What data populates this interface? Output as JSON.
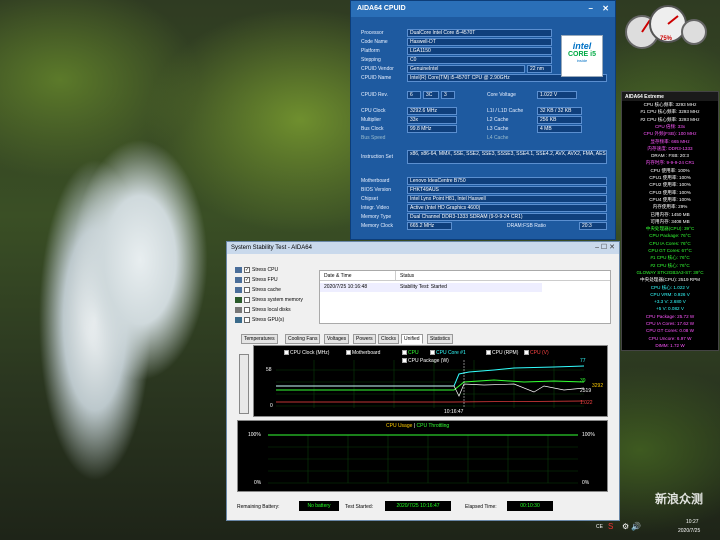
{
  "cpuid": {
    "title": "AIDA64 CPUID",
    "processor": {
      "label": "Processor",
      "value": "DualCore Intel Core i5-4570T"
    },
    "code_name": {
      "label": "Code Name",
      "value": "Haswell-DT"
    },
    "platform": {
      "label": "Platform",
      "value": "LGA1150"
    },
    "stepping": {
      "label": "Stepping",
      "value": "C0"
    },
    "vendor": {
      "label": "CPUID Vendor",
      "value": "GenuineIntel",
      "extra": "22 nm"
    },
    "name": {
      "label": "CPUID Name",
      "value": "Intel(R) Core(TM) i5-4570T CPU @ 2.90GHz"
    },
    "rev": {
      "label": "CPUID Rev.",
      "v1": "6",
      "v2": "3C",
      "v3": "3"
    },
    "core_voltage": {
      "label": "Core Voltage",
      "value": "1.022 V"
    },
    "cpu_clock": {
      "label": "CPU Clock",
      "value": "3292.6 MHz"
    },
    "multiplier": {
      "label": "Multiplier",
      "value": "33x"
    },
    "bus_clock": {
      "label": "Bus Clock",
      "value": "99.8 MHz"
    },
    "bus_speed": {
      "label": "Bus Speed"
    },
    "l1": {
      "label": "L1I / L1D Cache",
      "value": "32 KB / 32 KB"
    },
    "l2": {
      "label": "L2 Cache",
      "value": "256 KB"
    },
    "l3": {
      "label": "L3 Cache",
      "value": "4 MB"
    },
    "l4": {
      "label": "L4 Cache"
    },
    "iset": {
      "label": "Instruction Set",
      "value": "x86, x86-64, MMX, SSE, SSE2, SSE3, SSSE3, SSE4.1, SSE4.2, AVX, AVX2, FMA, AES"
    },
    "motherboard": {
      "label": "Motherboard",
      "value": "Lenovo IdeaCentre B750"
    },
    "bios": {
      "label": "BIOS Version",
      "value": "FHKT49AUS"
    },
    "chipset": {
      "label": "Chipset",
      "value": "Intel Lynx Point H81, Intel Haswell"
    },
    "video": {
      "label": "Integr. Video",
      "value": "Active (Intel HD Graphics 4600)"
    },
    "memtype": {
      "label": "Memory Type",
      "value": "Dual Channel DDR3-1333 SDRAM (9-9-9-24 CR1)"
    },
    "memclock": {
      "label": "Memory Clock",
      "value": "665.2 MHz"
    },
    "ratio": {
      "label": "DRAM:FSB Ratio",
      "value": "20:3"
    },
    "intel": {
      "brand": "intel",
      "core": "CORE i5",
      "inside": "inside"
    }
  },
  "stability": {
    "title": "System Stability Test - AIDA64",
    "checks": [
      {
        "label": "Stress CPU",
        "checked": true
      },
      {
        "label": "Stress FPU",
        "checked": true
      },
      {
        "label": "Stress cache",
        "checked": false
      },
      {
        "label": "Stress system memory",
        "checked": false
      },
      {
        "label": "Stress local disks",
        "checked": false
      },
      {
        "label": "Stress GPU(s)",
        "checked": false
      }
    ],
    "table": {
      "col1": "Date & Time",
      "col2": "Status",
      "row_time": "2020/7/25 10:16:48",
      "row_status": "Stability Test: Started"
    },
    "tabs": [
      "Temperatures",
      "Cooling Fans",
      "Voltages",
      "Powers",
      "Clocks",
      "Unified",
      "Statistics"
    ],
    "active_tab": "Unified",
    "legend": [
      {
        "label": "CPU Clock (MHz)",
        "color": "#ffffff",
        "checked": true
      },
      {
        "label": "Motherboard",
        "color": "#ffffff",
        "checked": false
      },
      {
        "label": "CPU",
        "color": "#33ff33",
        "checked": true
      },
      {
        "label": "CPU Core #1",
        "color": "#33ffff",
        "checked": true
      },
      {
        "label": "CPU (RPM)",
        "color": "#ffffff",
        "checked": true
      },
      {
        "label": "CPU (V)",
        "color": "#ff4444",
        "checked": true
      },
      {
        "label": "CPU Package (W)",
        "color": "#ffffff",
        "checked": false
      }
    ],
    "graph1": {
      "ymax": "58",
      "ymin": "0",
      "time": "10:16:47",
      "r1": "77",
      "r2": "39",
      "r3": "3292",
      "r4": "2519",
      "r5": "1.022"
    },
    "graph2": {
      "title_a": "CPU Usage",
      "sep": "|",
      "title_b": "CPU Throttling",
      "ytop": "100%",
      "ybot": "0%",
      "rtop": "100%",
      "rbot": "0%"
    },
    "remaining_label": "Remaining Battery:",
    "remaining_value": "No battery",
    "started_label": "Test Started:",
    "started_value": "2020/7/25 10:16:47",
    "elapsed_label": "Elapsed Time:",
    "elapsed_value": "00:10:30"
  },
  "extreme": {
    "title": "AIDA64 Extreme",
    "lines": [
      {
        "t": "CPU 核心频率: 3293 MHz",
        "c": "#ffffff"
      },
      {
        "t": "#1 CPU 核心频率: 3293 MHz",
        "c": "#ffffff"
      },
      {
        "t": "#2 CPU 核心频率: 3293 MHz",
        "c": "#ffffff"
      },
      {
        "t": "CPU 倍频: 33x",
        "c": "#ff55ff"
      },
      {
        "t": "CPU 外频(FSB): 100 MHz",
        "c": "#ff55ff"
      },
      {
        "t": "显存频率: 665 MHz",
        "c": "#ff55ff"
      },
      {
        "t": "内存速度: DDR3-1333",
        "c": "#ff55ff"
      },
      {
        "t": "DRAM : FSB: 20:3",
        "c": "#ffffff"
      },
      {
        "t": "内存时序: 9-9-9-24 CR1",
        "c": "#ff55ff"
      },
      {
        "t": "CPU 使用率: 100%",
        "c": "#ffffff"
      },
      {
        "t": "CPU1 使用率: 100%",
        "c": "#ffffff"
      },
      {
        "t": "CPU2 使用率: 100%",
        "c": "#ffffff"
      },
      {
        "t": "CPU3 使用率: 100%",
        "c": "#ffffff"
      },
      {
        "t": "CPU4 使用率: 100%",
        "c": "#ffffff"
      },
      {
        "t": "内存使用率: 29%",
        "c": "#ffffff"
      },
      {
        "t": "已用内存: 1450 MB",
        "c": "#ffffff"
      },
      {
        "t": "可用内存: 3408 MB",
        "c": "#ffffff"
      },
      {
        "t": "中央处理器(CPU): 39°C",
        "c": "#33ff33"
      },
      {
        "t": "CPU Package: 76°C",
        "c": "#33ff33"
      },
      {
        "t": "CPU IA Cores: 76°C",
        "c": "#33ff33"
      },
      {
        "t": "CPU GT Cores: 67°C",
        "c": "#33ff33"
      },
      {
        "t": "#1 CPU 核心: 76°C",
        "c": "#33ff33"
      },
      {
        "t": "#2 CPU 核心: 76°C",
        "c": "#33ff33"
      },
      {
        "t": "GLOWAY STK2GB3A3-S7: 39°C",
        "c": "#33ff33"
      },
      {
        "t": "中央处理器(CPU): 2519 RPM",
        "c": "#ffffff"
      },
      {
        "t": "CPU 核心: 1.022 V",
        "c": "#33ffff"
      },
      {
        "t": "CPU VRM: 0.926 V",
        "c": "#33ffff"
      },
      {
        "t": "+3.3 V: 2.680 V",
        "c": "#33ffff"
      },
      {
        "t": "+5 V: 0.082 V",
        "c": "#33ffff"
      },
      {
        "t": "CPU Package: 25.72 W",
        "c": "#ff55ff"
      },
      {
        "t": "CPU IA Cores: 17.62 W",
        "c": "#ff55ff"
      },
      {
        "t": "CPU GT Cores: 0.08 W",
        "c": "#ff55ff"
      },
      {
        "t": "CPU Uncore: 6.97 W",
        "c": "#ff55ff"
      },
      {
        "t": "DIMM: 1.72 W",
        "c": "#ff55ff"
      }
    ]
  },
  "gauge": {
    "value": "75%"
  },
  "watermark": "新浪众测",
  "taskbar": {
    "time": "10:27",
    "date": "2020/7/25",
    "ime": "CE"
  }
}
